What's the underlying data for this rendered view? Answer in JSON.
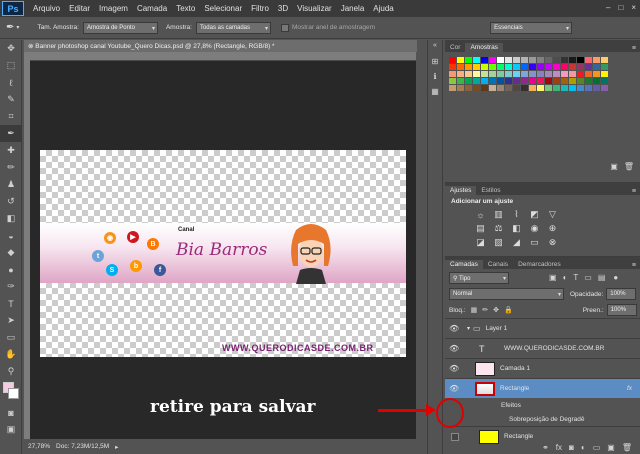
{
  "app": {
    "logo": "Ps"
  },
  "menu": [
    "Arquivo",
    "Editar",
    "Imagem",
    "Camada",
    "Texto",
    "Selecionar",
    "Filtro",
    "3D",
    "Visualizar",
    "Janela",
    "Ajuda"
  ],
  "window_controls": [
    "–",
    "□",
    "×"
  ],
  "options": {
    "sample_size_label": "Tam. Amostra:",
    "sample_size_value": "Amostra de Ponto",
    "sample_label": "Amostra:",
    "sample_value": "Todas as camadas",
    "show_ring_label": "Mostrar anel de amostragem",
    "workspace": "Essenciais"
  },
  "document": {
    "tab_title": "Banner photoshop canal Youtube_Quero Dicas.psd @ 27,8% (Rectangle, RGB/8) *",
    "zoom": "27,78%",
    "doc_size": "Doc: 7,23M/12,5M"
  },
  "banner": {
    "canal": "Canal",
    "name": "Bia Barros",
    "url": "WWW.QUERODICASDE.COM.BR"
  },
  "panels": {
    "color_tab": "Cor",
    "swatches_tab": "Amostras",
    "adjust_tab": "Ajustes",
    "styles_tab": "Estilos",
    "add_adjust": "Adicionar um ajuste",
    "layers_tab": "Camadas",
    "channels_tab": "Canais",
    "paths_tab": "Demarcadores",
    "filter_kind": "Tipo",
    "blend_mode": "Normal",
    "opacity_label": "Opacidade:",
    "opacity_value": "100%",
    "lock_label": "Bloq.:",
    "fill_label": "Preen.:",
    "fill_value": "100%"
  },
  "layers": [
    {
      "name": "Layer 1",
      "type": "group"
    },
    {
      "name": "WWW.QUERODICASDE.COM.BR",
      "type": "text"
    },
    {
      "name": "Camada 1",
      "type": "pixel"
    },
    {
      "name": "Rectangle",
      "type": "shape",
      "fx": "fx"
    },
    {
      "name": "Efeitos",
      "type": "effects"
    },
    {
      "name": "Sobreposição de Degradê",
      "type": "effect"
    },
    {
      "name": "Rectangle",
      "type": "shape-yellow"
    }
  ],
  "annotation": "retire para salvar",
  "colors": {
    "accent_red": "#e00000",
    "ps_blue": "#49b2ff",
    "selected_layer": "#5b8cc4",
    "brand_purple": "#9b2b7a"
  },
  "swatch_colors": [
    "#ff0000",
    "#ffff00",
    "#00ff00",
    "#00ffff",
    "#0000ff",
    "#ff00ff",
    "#ffffff",
    "#e6e6e6",
    "#cccccc",
    "#b3b3b3",
    "#999999",
    "#808080",
    "#666666",
    "#4d4d4d",
    "#333333",
    "#1a1a1a",
    "#000000",
    "#ff6666",
    "#ff9966",
    "#ffcc66",
    "#ff3300",
    "#ff6600",
    "#ff9900",
    "#ffcc00",
    "#ccff00",
    "#66ff00",
    "#00ff66",
    "#00ffcc",
    "#00ccff",
    "#0066ff",
    "#3300ff",
    "#9900ff",
    "#cc00ff",
    "#ff00cc",
    "#ff0066",
    "#cc3333",
    "#993366",
    "#663399",
    "#336699",
    "#339966",
    "#f7977a",
    "#f9ad81",
    "#fdc68a",
    "#fff79a",
    "#c4df9b",
    "#a2d39c",
    "#82ca9d",
    "#7bcdc8",
    "#6ecff6",
    "#7ea7d8",
    "#8493ca",
    "#8882be",
    "#a187be",
    "#bc8dbf",
    "#f49ac2",
    "#f6989d",
    "#ed1c24",
    "#f26522",
    "#f7941d",
    "#fff200",
    "#8dc63f",
    "#39b54a",
    "#00a651",
    "#00a99d",
    "#00aeef",
    "#0072bc",
    "#0054a6",
    "#2e3192",
    "#662d91",
    "#92278f",
    "#ec008c",
    "#ed145b",
    "#9e0b0f",
    "#a0410d",
    "#a36209",
    "#aba000",
    "#598527",
    "#197b30",
    "#007236",
    "#00746b",
    "#c69c6d",
    "#a67c52",
    "#8c6239",
    "#754c24",
    "#603913",
    "#c7b299",
    "#998675",
    "#736357",
    "#534741",
    "#362f2d",
    "#fbaf5d",
    "#fff568",
    "#7cc576",
    "#3bb878",
    "#1abbb4",
    "#00bff3",
    "#438ccb",
    "#5574b9",
    "#605ca8",
    "#855fa8"
  ]
}
